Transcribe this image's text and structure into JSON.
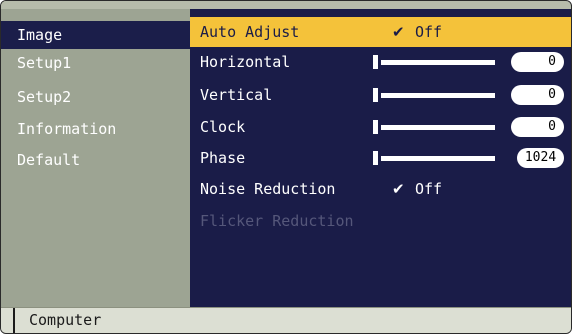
{
  "menu": {
    "items": [
      {
        "label": "Image"
      },
      {
        "label": "Setup1"
      },
      {
        "label": "Setup2"
      },
      {
        "label": "Information"
      },
      {
        "label": "Default"
      }
    ],
    "selected": "Image"
  },
  "settings": {
    "auto_adjust": {
      "label": "Auto Adjust",
      "check": "✔",
      "value": "Off"
    },
    "horizontal": {
      "label": "Horizontal",
      "value": "0",
      "level": 0
    },
    "vertical": {
      "label": "Vertical",
      "value": "0",
      "level": 0
    },
    "clock": {
      "label": "Clock",
      "value": "0",
      "level": 0
    },
    "phase": {
      "label": "Phase",
      "value": "1024",
      "level": 0
    },
    "noise_reduction": {
      "label": "Noise Reduction",
      "check": "✔",
      "value": "Off"
    },
    "flicker_reduction": {
      "label": "Flicker Reduction",
      "enabled": false
    }
  },
  "status": {
    "source": "Computer"
  },
  "colors": {
    "panel": "#1a1c48",
    "menu_bg": "#9da493",
    "highlight": "#f4c23a",
    "disabled_text": "#55577a"
  }
}
